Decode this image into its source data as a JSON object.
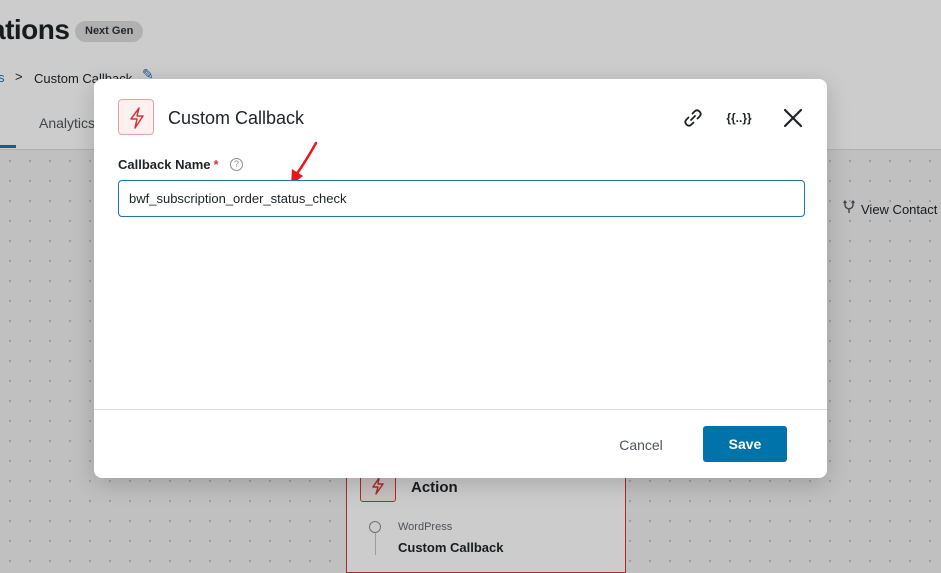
{
  "page": {
    "title": "ations",
    "badge": "Next Gen",
    "breadcrumb": {
      "previous": "s",
      "separator": ">",
      "current": "Custom Callback"
    },
    "tabs": [
      {
        "label": "Analytics"
      }
    ],
    "view_contact_label": "View Contact"
  },
  "canvas": {
    "action_node": {
      "label": "Action",
      "source": "WordPress",
      "name": "Custom Callback"
    }
  },
  "modal": {
    "title": "Custom Callback",
    "vars_button_label": "{{..}}",
    "field": {
      "label": "Callback Name",
      "required_marker": "*",
      "help_glyph": "?",
      "value": "bwf_subscription_order_status_check"
    },
    "cancel_label": "Cancel",
    "save_label": "Save"
  },
  "colors": {
    "accent": "#0073aa",
    "required": "#d63638",
    "annotation_arrow": "#e8171c"
  },
  "icons": {
    "modal_icon": "lightning-icon",
    "link": "link-icon",
    "variables": "curly-braces-icon",
    "close": "close-icon",
    "help": "help-circle-icon",
    "view_contact": "branch-icon",
    "edit": "pencil-icon"
  }
}
